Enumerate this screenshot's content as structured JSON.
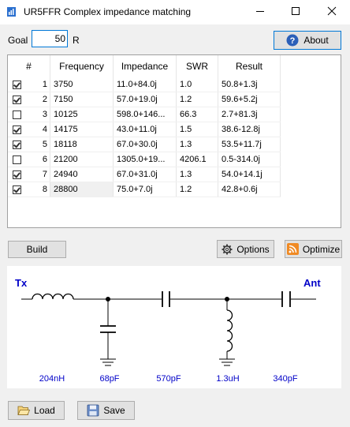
{
  "window": {
    "title": "UR5FFR Complex impedance matching",
    "minimize": "—",
    "maximize": "☐",
    "close": "✕"
  },
  "goal": {
    "label": "Goal",
    "value": "50",
    "unit": "R"
  },
  "buttons": {
    "about": "About",
    "build": "Build",
    "options": "Options",
    "optimize": "Optimize",
    "load": "Load",
    "save": "Save"
  },
  "table": {
    "headers": [
      "#",
      "Frequency",
      "Impedance",
      "SWR",
      "Result"
    ],
    "rows": [
      {
        "checked": true,
        "n": "1",
        "freq": "3750",
        "imp": "11.0+84.0j",
        "swr": "1.0",
        "res": "50.8+1.3j"
      },
      {
        "checked": true,
        "n": "2",
        "freq": "7150",
        "imp": "57.0+19.0j",
        "swr": "1.2",
        "res": "59.6+5.2j"
      },
      {
        "checked": false,
        "n": "3",
        "freq": "10125",
        "imp": "598.0+146...",
        "swr": "66.3",
        "res": "2.7+81.3j"
      },
      {
        "checked": true,
        "n": "4",
        "freq": "14175",
        "imp": "43.0+11.0j",
        "swr": "1.5",
        "res": "38.6-12.8j"
      },
      {
        "checked": true,
        "n": "5",
        "freq": "18118",
        "imp": "67.0+30.0j",
        "swr": "1.3",
        "res": "53.5+11.7j"
      },
      {
        "checked": false,
        "n": "6",
        "freq": "21200",
        "imp": "1305.0+19...",
        "swr": "4206.1",
        "res": "0.5-314.0j"
      },
      {
        "checked": true,
        "n": "7",
        "freq": "24940",
        "imp": "67.0+31.0j",
        "swr": "1.3",
        "res": "54.0+14.1j"
      },
      {
        "checked": true,
        "n": "8",
        "freq": "28800",
        "imp": "75.0+7.0j",
        "swr": "1.2",
        "res": "42.8+0.6j"
      }
    ]
  },
  "schematic": {
    "tx_label": "Tx",
    "ant_label": "Ant",
    "components": [
      "204nH",
      "68pF",
      "570pF",
      "1.3uH",
      "340pF"
    ],
    "colors": {
      "labels": "#0000c8",
      "wire": "#000000"
    }
  }
}
